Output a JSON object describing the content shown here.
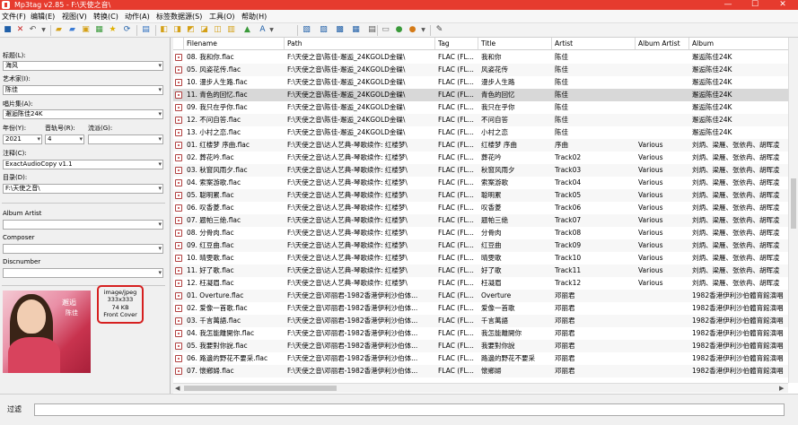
{
  "titlebar": {
    "title": "Mp3tag v2.85  -  F:\\天使之音\\",
    "min": "—",
    "max": "☐",
    "close": "✕"
  },
  "menu": [
    "文件(F)",
    "编辑(E)",
    "视图(V)",
    "转换(C)",
    "动作(A)",
    "标签数据源(S)",
    "工具(O)",
    "帮助(H)"
  ],
  "toolbar_icons": [
    "save-icon",
    "remove-icon",
    "undo-icon",
    "dropdown-icon",
    "open-folder-icon",
    "add-folder-icon",
    "favorites-icon",
    "refresh-icon",
    "playlist-icon",
    "star-icon",
    "reload-icon",
    "select-icon",
    "export-icon",
    "tag-to-filename-icon",
    "filename-to-tag-icon",
    "text-to-tag-icon",
    "tag-to-tag-icon",
    "autonumber-icon",
    "case-convert-icon",
    "format-icon",
    "options-icon",
    "freedb-icon",
    "discogs-icon",
    "musicbrainz-icon",
    "amazon-icon",
    "web-icon",
    "print-icon",
    "tools-icon"
  ],
  "left": {
    "title_label": "标题(L):",
    "title_value": "海风",
    "artist_label": "艺术家(I):",
    "artist_value": "陈佳",
    "album_label": "唱片集(A):",
    "album_value": "邂逅陈佳24K",
    "year_label": "年份(Y):",
    "year_value": "2021",
    "track_label": "音轨号(R):",
    "track_value": "4",
    "genre_label": "流派(G):",
    "genre_value": "",
    "comment_label": "注释(C):",
    "comment_value": "ExactAudioCopy v1.1",
    "dir_label": "目录(D):",
    "dir_value": "F:\\天使之音\\",
    "albumartist_label": "Album Artist",
    "albumartist_value": "",
    "composer_label": "Composer",
    "composer_value": "",
    "discnumber_label": "Discnumber",
    "discnumber_value": "",
    "cover_title1": "邂逅",
    "cover_title2": "陈佳",
    "cover_info": [
      "image/jpeg",
      "333x333",
      "74 KB",
      "Front Cover"
    ]
  },
  "grid": {
    "columns": [
      "Filename",
      "Path",
      "Tag",
      "Title",
      "Artist",
      "Album Artist",
      "Album"
    ],
    "rows": [
      [
        "08. 我和你.flac",
        "F:\\天使之音\\陈佳-邂逅_24KGOLD金碟\\",
        "FLAC (FL...",
        "我和你",
        "陈佳",
        "",
        "邂逅陈佳24K"
      ],
      [
        "05. 风姿花传.flac",
        "F:\\天使之音\\陈佳-邂逅_24KGOLD金碟\\",
        "FLAC (FL...",
        "风姿花传",
        "陈佳",
        "",
        "邂逅陈佳24K"
      ],
      [
        "10. 漫步人生路.flac",
        "F:\\天使之音\\陈佳-邂逅_24KGOLD金碟\\",
        "FLAC (FL...",
        "漫步人生路",
        "陈佳",
        "",
        "邂逅陈佳24K"
      ],
      [
        "11. 青色的回忆.flac",
        "F:\\天使之音\\陈佳-邂逅_24KGOLD金碟\\",
        "FLAC (FL...",
        "青色的回忆",
        "陈佳",
        "",
        "邂逅陈佳24K"
      ],
      [
        "09. 我只在乎你.flac",
        "F:\\天使之音\\陈佳-邂逅_24KGOLD金碟\\",
        "FLAC (FL...",
        "我只在乎你",
        "陈佳",
        "",
        "邂逅陈佳24K"
      ],
      [
        "12. 不问自答.flac",
        "F:\\天使之音\\陈佳-邂逅_24KGOLD金碟\\",
        "FLAC (FL...",
        "不问自答",
        "陈佳",
        "",
        "邂逅陈佳24K"
      ],
      [
        "13. 小村之恋.flac",
        "F:\\天使之音\\陈佳-邂逅_24KGOLD金碟\\",
        "FLAC (FL...",
        "小村之恋",
        "陈佳",
        "",
        "邂逅陈佳24K"
      ],
      [
        "01. 红楼梦 序曲.flac",
        "F:\\天使之音\\达人艺典-琴歌续作: 红楼梦\\",
        "FLAC (FL...",
        "红楼梦 序曲",
        "序曲",
        "Various",
        "刘炳、梁雁、张依冉、胡晖凌"
      ],
      [
        "02. 葬花吟.flac",
        "F:\\天使之音\\达人艺典-琴歌续作: 红楼梦\\",
        "FLAC (FL...",
        "葬花吟",
        "Track02",
        "Various",
        "刘炳、梁雁、张依冉、胡晖凌"
      ],
      [
        "03. 秋窗风雨夕.flac",
        "F:\\天使之音\\达人艺典-琴歌续作: 红楼梦\\",
        "FLAC (FL...",
        "秋窗风雨夕",
        "Track03",
        "Various",
        "刘炳、梁雁、张依冉、胡晖凌"
      ],
      [
        "04. 索案游歌.flac",
        "F:\\天使之音\\达人艺典-琴歌续作: 红楼梦\\",
        "FLAC (FL...",
        "索案游歌",
        "Track04",
        "Various",
        "刘炳、梁雁、张依冉、胡晖凌"
      ],
      [
        "05. 聪明累.flac",
        "F:\\天使之音\\达人艺典-琴歌续作: 红楼梦\\",
        "FLAC (FL...",
        "聪明累",
        "Track05",
        "Various",
        "刘炳、梁雁、张依冉、胡晖凌"
      ],
      [
        "06. 叹香菱.flac",
        "F:\\天使之音\\达人艺典-琴歌续作: 红楼梦\\",
        "FLAC (FL...",
        "叹香菱",
        "Track06",
        "Various",
        "刘炳、梁雁、张依冉、胡晖凌"
      ],
      [
        "07. 题帕三绝.flac",
        "F:\\天使之音\\达人艺典-琴歌续作: 红楼梦\\",
        "FLAC (FL...",
        "题帕三绝",
        "Track07",
        "Various",
        "刘炳、梁雁、张依冉、胡晖凌"
      ],
      [
        "08. 分骨肉.flac",
        "F:\\天使之音\\达人艺典-琴歌续作: 红楼梦\\",
        "FLAC (FL...",
        "分骨肉",
        "Track08",
        "Various",
        "刘炳、梁雁、张依冉、胡晖凌"
      ],
      [
        "09. 红豆曲.flac",
        "F:\\天使之音\\达人艺典-琴歌续作: 红楼梦\\",
        "FLAC (FL...",
        "红豆曲",
        "Track09",
        "Various",
        "刘炳、梁雁、张依冉、胡晖凌"
      ],
      [
        "10. 晴雯歌.flac",
        "F:\\天使之音\\达人艺典-琴歌续作: 红楼梦\\",
        "FLAC (FL...",
        "晴雯歌",
        "Track10",
        "Various",
        "刘炳、梁雁、张依冉、胡晖凌"
      ],
      [
        "11. 好了歌.flac",
        "F:\\天使之音\\达人艺典-琴歌续作: 红楼梦\\",
        "FLAC (FL...",
        "好了歌",
        "Track11",
        "Various",
        "刘炳、梁雁、张依冉、胡晖凌"
      ],
      [
        "12. 枉凝眉.flac",
        "F:\\天使之音\\达人艺典-琴歌续作: 红楼梦\\",
        "FLAC (FL...",
        "枉凝眉",
        "Track12",
        "Various",
        "刘炳、梁雁、张依冉、胡晖凌"
      ],
      [
        "01. Overture.flac",
        "F:\\天使之音\\邓丽君-1982香港伊利沙伯体...",
        "FLAC (FL...",
        "Overture",
        "邓丽君",
        "",
        "1982香港伊利沙伯體育館演唱"
      ],
      [
        "02. 爱像一首歌.flac",
        "F:\\天使之音\\邓丽君-1982香港伊利沙伯体...",
        "FLAC (FL...",
        "爱像一首歌",
        "邓丽君",
        "",
        "1982香港伊利沙伯體育館演唱"
      ],
      [
        "03. 千言萬語.flac",
        "F:\\天使之音\\邓丽君-1982香港伊利沙伯体...",
        "FLAC (FL...",
        "千言萬語",
        "邓丽君",
        "",
        "1982香港伊利沙伯體育館演唱"
      ],
      [
        "04. 我怎能離開你.flac",
        "F:\\天使之音\\邓丽君-1982香港伊利沙伯体...",
        "FLAC (FL...",
        "我怎能離開你",
        "邓丽君",
        "",
        "1982香港伊利沙伯體育館演唱"
      ],
      [
        "05. 我要對你說.flac",
        "F:\\天使之音\\邓丽君-1982香港伊利沙伯体...",
        "FLAC (FL...",
        "我要對你說",
        "邓丽君",
        "",
        "1982香港伊利沙伯體育館演唱"
      ],
      [
        "06. 路邊的野花不要采.flac",
        "F:\\天使之音\\邓丽君-1982香港伊利沙伯体...",
        "FLAC (FL...",
        "路邊的野花不要采",
        "邓丽君",
        "",
        "1982香港伊利沙伯體育館演唱"
      ],
      [
        "07. 懷鄉婦.flac",
        "F:\\天使之音\\邓丽君-1982香港伊利沙伯体...",
        "FLAC (FL...",
        "懷鄉婦",
        "邓丽君",
        "",
        "1982香港伊利沙伯體育館演唱"
      ]
    ],
    "selected_index": 3
  },
  "hscroll": {
    "left": "◀",
    "right": "▶"
  },
  "status": {
    "filter_label": "过滤",
    "filter_value": ""
  }
}
